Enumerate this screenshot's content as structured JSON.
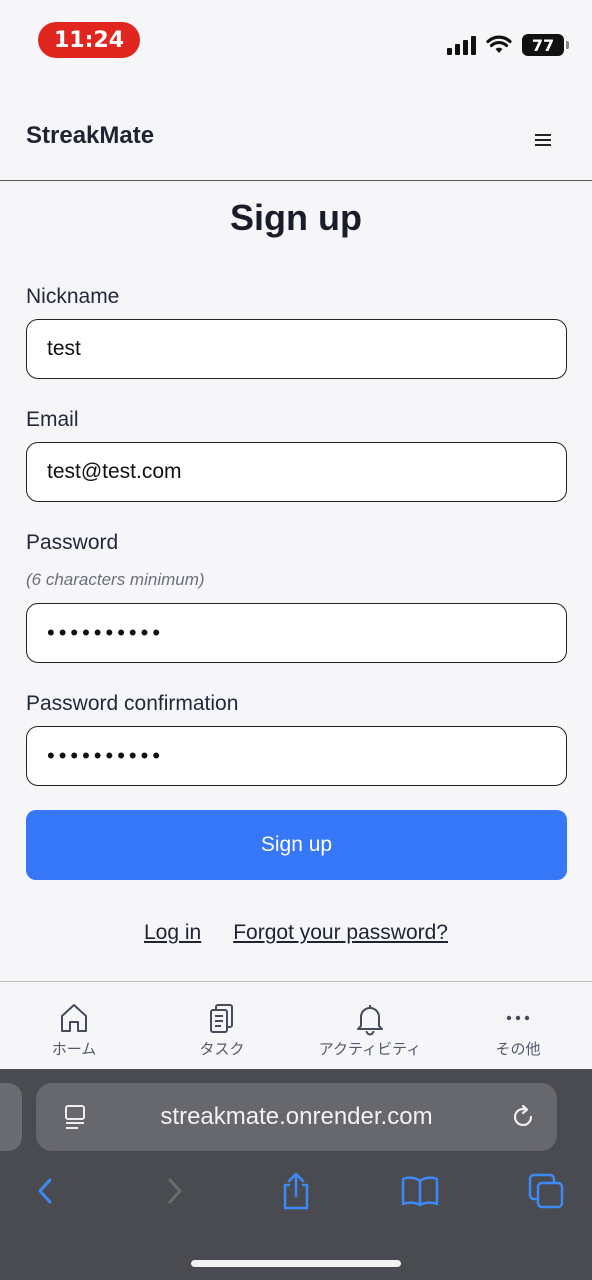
{
  "status_bar": {
    "time": "11:24",
    "battery": "77"
  },
  "header": {
    "brand": "StreakMate",
    "menu_icon": "hamburger-icon"
  },
  "form": {
    "title": "Sign up",
    "nickname_label": "Nickname",
    "nickname_value": "test",
    "email_label": "Email",
    "email_value": "test@test.com",
    "password_label": "Password",
    "password_hint": "(6 characters minimum)",
    "password_value": "••••••••••",
    "confirmation_label": "Password confirmation",
    "confirmation_value": "••••••••••",
    "submit_label": "Sign up",
    "login_link": "Log in",
    "forgot_link": "Forgot your password?"
  },
  "tab_bar": {
    "items": [
      {
        "label": "ホーム",
        "icon": "home-icon"
      },
      {
        "label": "タスク",
        "icon": "clipboard-icon"
      },
      {
        "label": "アクティビティ",
        "icon": "bell-icon"
      },
      {
        "label": "その他",
        "icon": "more-icon"
      }
    ]
  },
  "browser": {
    "url": "streakmate.onrender.com",
    "accent_color": "#3d8af7"
  },
  "colors": {
    "primary": "#3577f7",
    "time_pill": "#e0261f"
  }
}
